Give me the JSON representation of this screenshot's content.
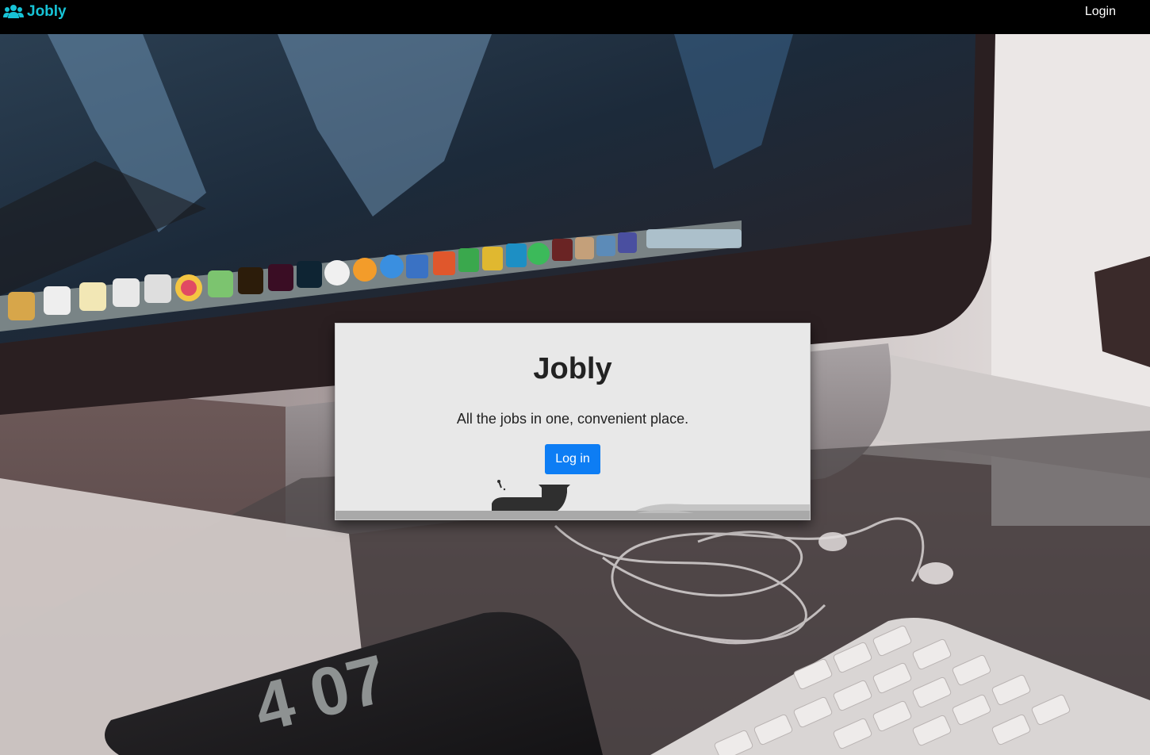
{
  "navbar": {
    "brand": "Jobly",
    "brand_icon": "users-icon",
    "login_link": "Login",
    "brand_color": "#17c3d6",
    "background": "#000000"
  },
  "hero": {
    "background_desc_icon": "desktop-photo",
    "clock_digits": "4 07"
  },
  "card": {
    "title": "Jobly",
    "subtitle": "All the jobs in one, convenient place.",
    "login_button": "Log in",
    "button_color": "#0d7df4"
  }
}
